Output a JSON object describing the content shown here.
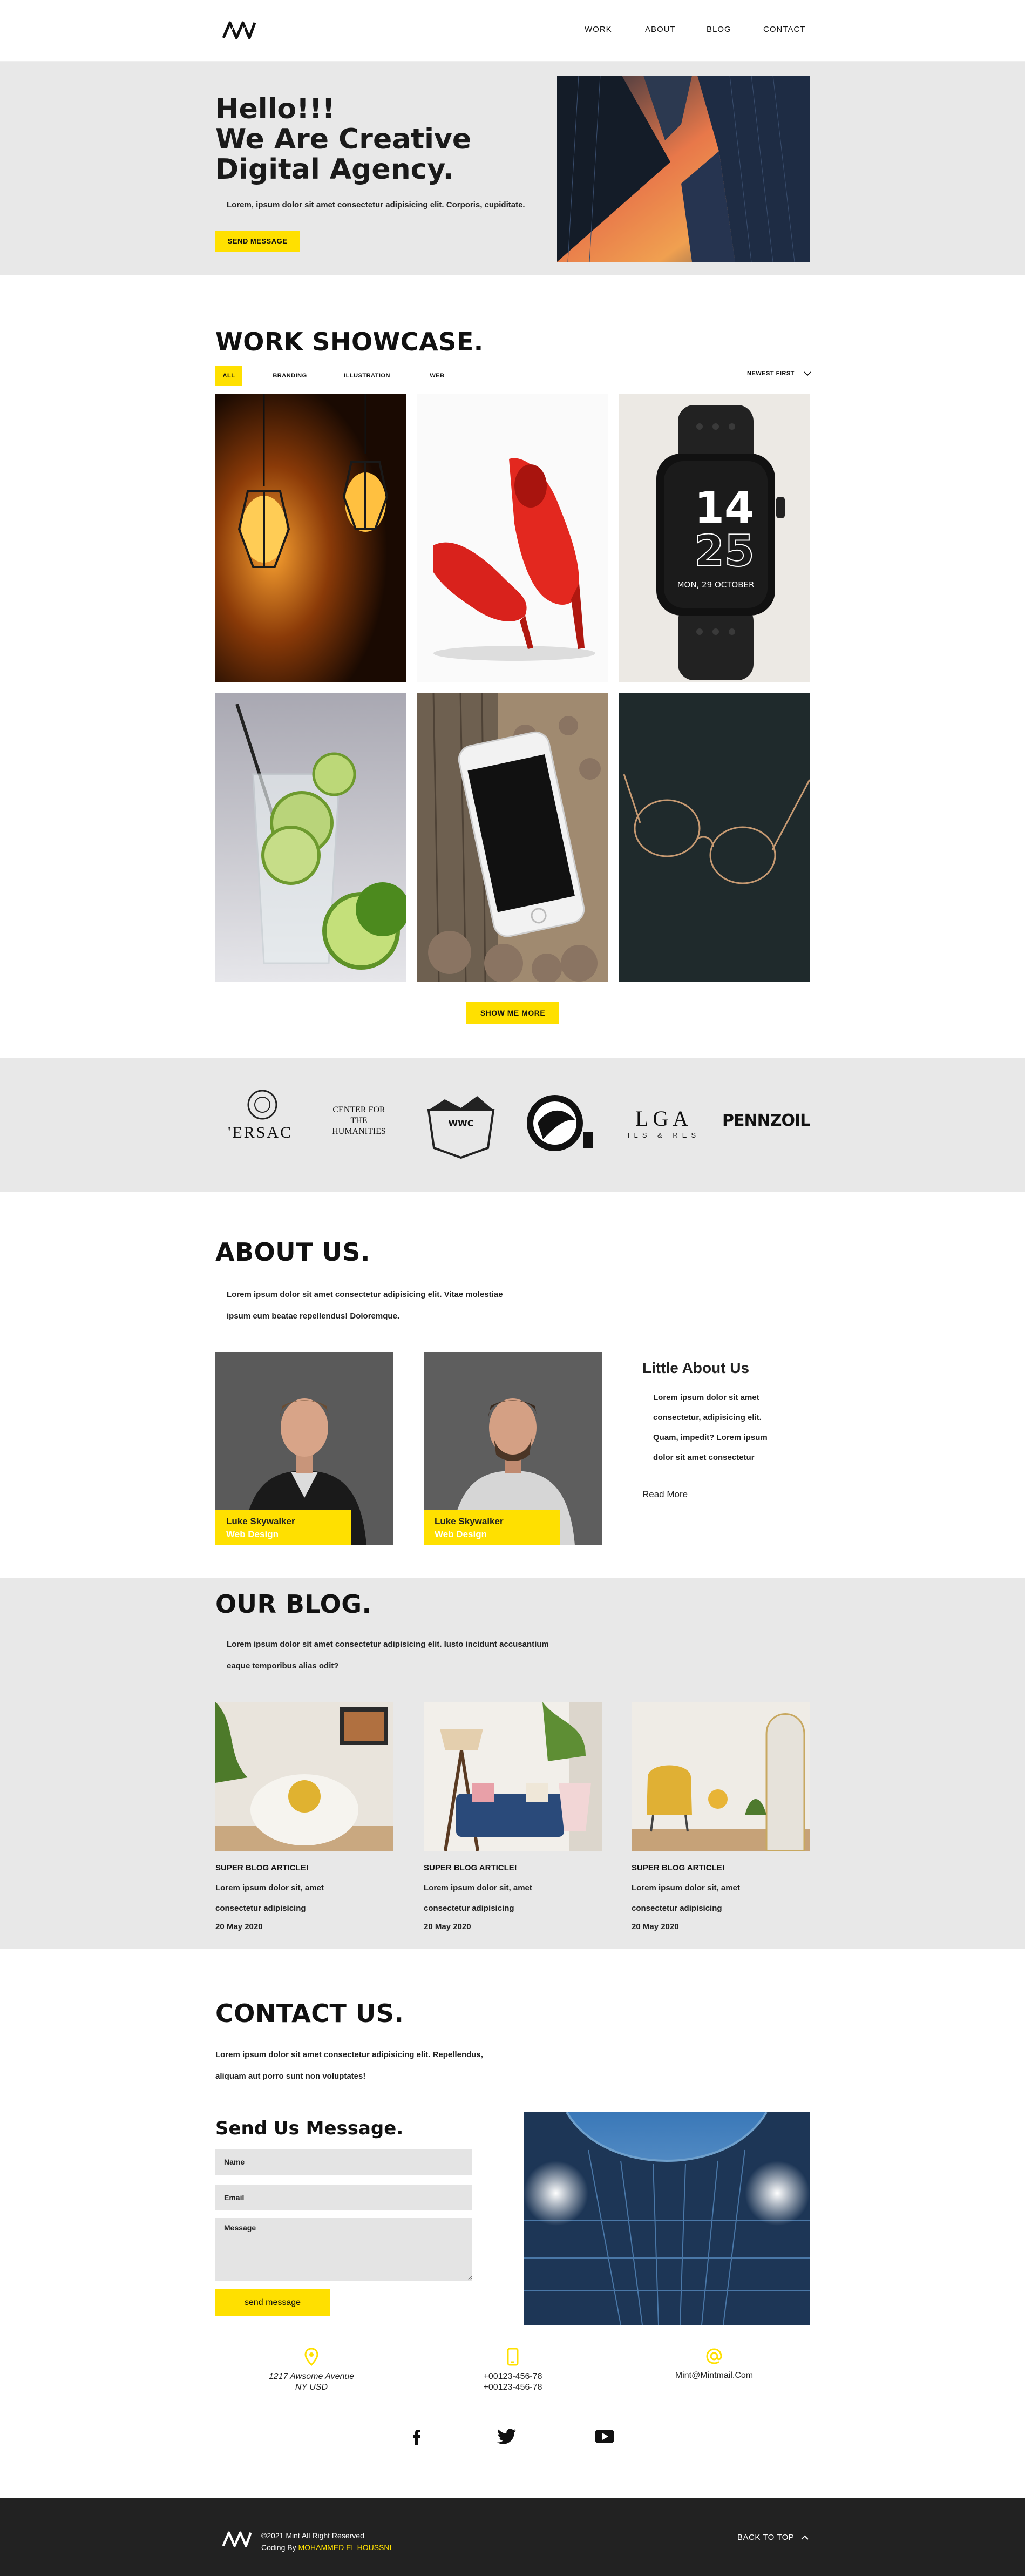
{
  "header": {
    "logo": "M",
    "nav": [
      "WORK",
      "ABOUT",
      "BLOG",
      "CONTACT"
    ]
  },
  "hero": {
    "title_lines": [
      "Hello!!!",
      "We Are Creative",
      "Digital Agency."
    ],
    "text": "Lorem, ipsum dolor sit amet consectetur adipisicing elit. Corporis, cupiditate.",
    "button": "SEND MESSAGE"
  },
  "showcase": {
    "title": "WORK SHOWCASE.",
    "filters": [
      "ALL",
      "BRANDING",
      "ILLUSTRATION",
      "WEB"
    ],
    "sort": "NEWEST FIRST",
    "watch_time_top": "14",
    "watch_time_bottom": "25",
    "watch_date": "MON, 29 OCTOBER",
    "button": "SHOW ME MORE"
  },
  "brands": {
    "items": [
      "'ERSAC",
      "CENTER FOR THE HUMANITIES",
      "WWC",
      "",
      "LGA",
      "PENNZOIL"
    ],
    "lga_sub": "ILS & RES"
  },
  "about": {
    "title": "ABOUT US.",
    "text_lines": [
      "Lorem ipsum dolor sit amet consectetur adipisicing elit. Vitae molestiae",
      "ipsum eum beatae repellendus! Doloremque."
    ],
    "members": [
      {
        "name": "Luke Skywalker",
        "role": "Web Design"
      },
      {
        "name": "Luke Skywalker",
        "role": "Web Design"
      }
    ],
    "little_title": "Little About Us",
    "little_lines": [
      "Lorem ipsum dolor sit amet",
      "consectetur, adipisicing elit.",
      "Quam, impedit? Lorem ipsum",
      "dolor sit amet consectetur"
    ],
    "read_more": "Read More"
  },
  "blog": {
    "title": "OUR BLOG.",
    "text_lines": [
      "Lorem ipsum dolor sit amet consectetur adipisicing elit. Iusto incidunt accusantium",
      "eaque temporibus alias odit?"
    ],
    "posts": [
      {
        "title": "SUPER BLOG ARTICLE!",
        "line1": "Lorem ipsum dolor sit, amet",
        "line2": "consectetur adipisicing",
        "date": "20 May 2020"
      },
      {
        "title": "SUPER BLOG ARTICLE!",
        "line1": "Lorem ipsum dolor sit, amet",
        "line2": "consectetur adipisicing",
        "date": "20 May 2020"
      },
      {
        "title": "SUPER BLOG ARTICLE!",
        "line1": "Lorem ipsum dolor sit, amet",
        "line2": "consectetur adipisicing",
        "date": "20 May 2020"
      }
    ]
  },
  "contact": {
    "title": "CONTACT US.",
    "text_lines": [
      "Lorem ipsum dolor sit amet consectetur adipisicing elit. Repellendus,",
      "aliquam aut porro sunt non voluptates!"
    ],
    "form_title": "Send Us Message.",
    "name_placeholder": "Name",
    "email_placeholder": "Email",
    "message_placeholder": "Message",
    "button": "send message",
    "address_line1": "1217 Awsome Avenue",
    "address_line2": "NY USD",
    "phone1": "+00123-456-78",
    "phone2": "+00123-456-78",
    "email": "Mint@Mintmail.Com"
  },
  "footer": {
    "copyright": "©2021 Mint All Right Reserved",
    "coding_by": "Coding By",
    "author": "MOHAMMED EL HOUSSNI",
    "back_to_top": "BACK TO TOP"
  },
  "colors": {
    "accent": "#ffe000",
    "section_bg": "#e8e8e8",
    "footer_bg": "#222222"
  },
  "icons": [
    "location-pin-icon",
    "phone-icon",
    "at-icon",
    "facebook-icon",
    "twitter-icon",
    "youtube-icon",
    "chevron-up-icon",
    "chevron-down-icon"
  ]
}
